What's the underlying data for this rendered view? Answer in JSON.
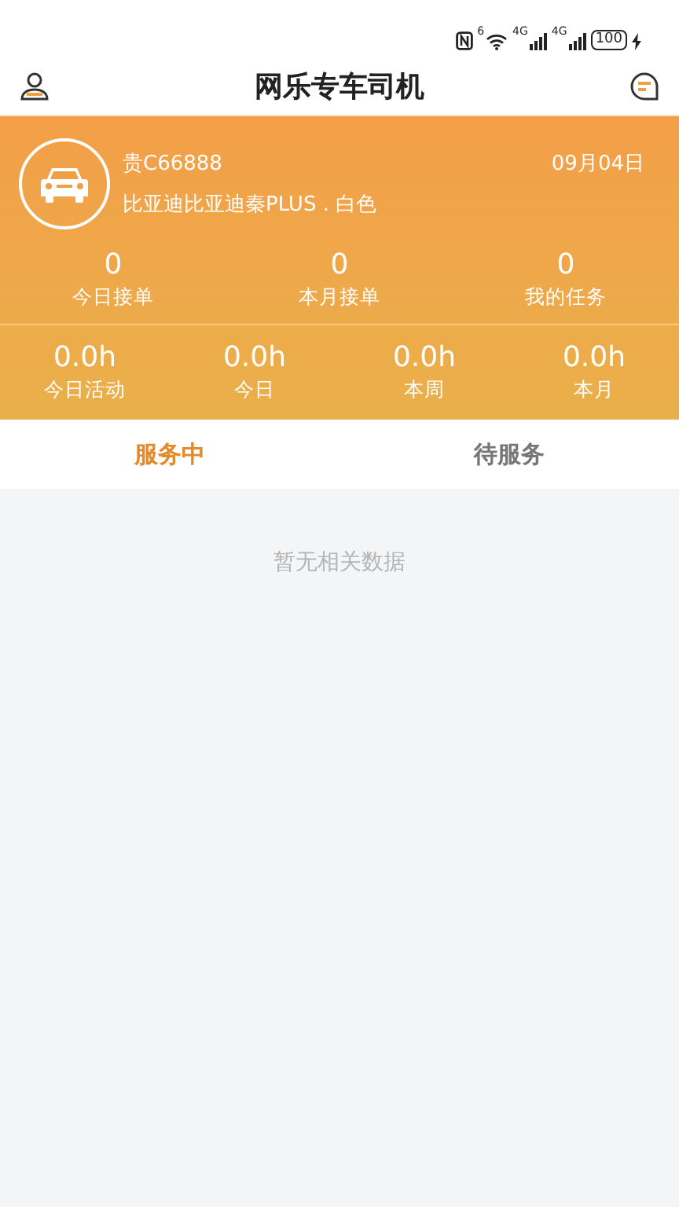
{
  "status_bar": {
    "wifi_label": "6",
    "signal_labels": [
      "4G",
      "4G"
    ],
    "battery": "100"
  },
  "header": {
    "title": "网乐专车司机"
  },
  "vehicle": {
    "plate": "贵C66888",
    "date": "09月04日",
    "model": "比亚迪比亚迪秦PLUS . 白色"
  },
  "order_stats": [
    {
      "value": "0",
      "label": "今日接单"
    },
    {
      "value": "0",
      "label": "本月接单"
    },
    {
      "value": "0",
      "label": "我的任务"
    }
  ],
  "hour_stats": [
    {
      "value": "0.0h",
      "label": "今日活动"
    },
    {
      "value": "0.0h",
      "label": "今日"
    },
    {
      "value": "0.0h",
      "label": "本周"
    },
    {
      "value": "0.0h",
      "label": "本月"
    }
  ],
  "tabs": [
    {
      "label": "服务中",
      "selected": true
    },
    {
      "label": "待服务",
      "selected": false
    }
  ],
  "empty_message": "暂无相关数据"
}
